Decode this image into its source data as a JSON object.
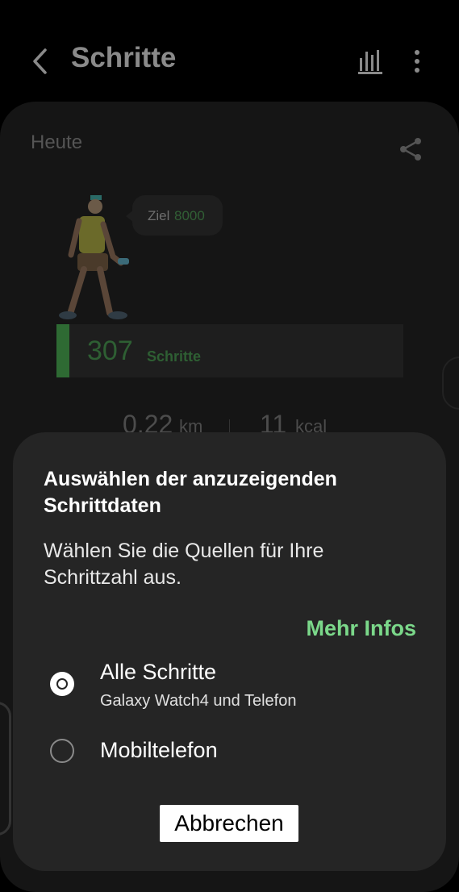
{
  "header": {
    "title": "Schritte",
    "back_icon": "chevron-left-icon",
    "chart_icon": "bar-chart-icon",
    "more_icon": "more-vertical-icon"
  },
  "card": {
    "day_label": "Heute",
    "share_icon": "share-icon",
    "goal_label": "Ziel",
    "goal_value": "8000",
    "steps_value": "307",
    "steps_unit": "Schritte",
    "distance_value": "0,22",
    "distance_unit": "km",
    "calories_value": "11",
    "calories_unit": "kcal"
  },
  "dialog": {
    "title": "Auswählen der anzuzeigenden Schrittdaten",
    "description": "Wählen Sie die Quellen für Ihre Schrittzahl aus.",
    "more_info": "Mehr Infos",
    "options": [
      {
        "label": "Alle Schritte",
        "sublabel": "Galaxy Watch4 und Telefon",
        "selected": true
      },
      {
        "label": "Mobiltelefon",
        "sublabel": "",
        "selected": false
      }
    ],
    "cancel_label": "Abbrechen"
  },
  "colors": {
    "accent_green": "#7bd88a",
    "steps_green": "#2e6a33",
    "dialog_bg": "#252525",
    "page_bg": "#000000"
  }
}
